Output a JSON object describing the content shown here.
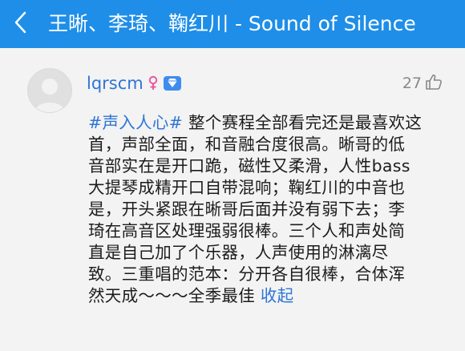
{
  "header": {
    "title": "王晰、李琦、鞠红川 - Sound of Silence",
    "back_icon": "chevron-left-icon",
    "background": "#1e8ee8"
  },
  "comment": {
    "username": "lqrscm",
    "gender_icon": "female-icon",
    "vip_icon": "diamond-vip-icon",
    "likes": "27",
    "like_icon": "thumbs-up-icon",
    "hashtag": "#声入人心#",
    "lines": [
      " 整个赛程全部看完还是最喜欢这",
      "首，声部全面，和音融合度很高。晰哥的低",
      "音部实在是开口跪，磁性又柔滑，人性bass",
      "大提琴成精开口自带混响；鞠红川的中音也",
      "是，开头紧跟在晰哥后面并没有弱下去；李",
      "琦在高音区处理强弱很棒。三个人和声处简",
      "直是自己加了个乐器，人声使用的淋漓尽",
      "致。三重唱的范本：分开各自很棒，合体浑",
      "然天成～～～全季最佳 "
    ],
    "collapse_label": "收起"
  },
  "colors": {
    "link": "#2f75d6",
    "text": "#1c1c1c",
    "muted": "#888888",
    "female": "#e85aa0",
    "vip": "#3f8cf0"
  }
}
